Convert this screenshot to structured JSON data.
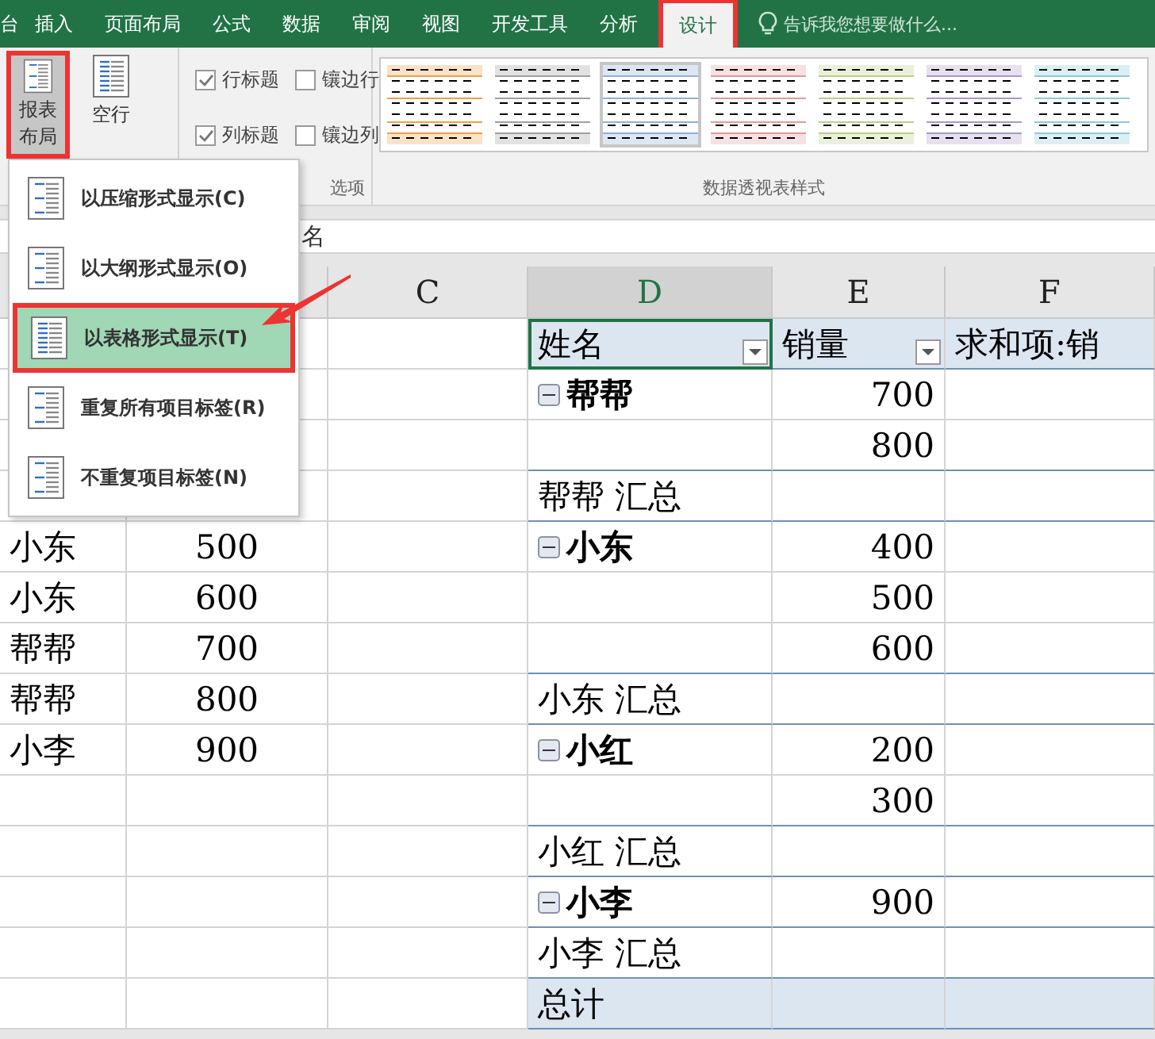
{
  "tabs": [
    {
      "label": "台",
      "selected": false
    },
    {
      "label": "插入",
      "selected": false
    },
    {
      "label": "页面布局",
      "selected": false
    },
    {
      "label": "公式",
      "selected": false
    },
    {
      "label": "数据",
      "selected": false
    },
    {
      "label": "审阅",
      "selected": false
    },
    {
      "label": "视图",
      "selected": false
    },
    {
      "label": "开发工具",
      "selected": false
    },
    {
      "label": "分析",
      "selected": false
    },
    {
      "label": "设计",
      "selected": true
    }
  ],
  "tell_me": "告诉我您想要做什么...",
  "layout_buttons": [
    {
      "label": "报表布局",
      "selected": true
    },
    {
      "label": "空行",
      "selected": false
    }
  ],
  "options": [
    {
      "label": "行标题",
      "checked": true
    },
    {
      "label": "镶边行",
      "checked": false
    },
    {
      "label": "列标题",
      "checked": true
    },
    {
      "label": "镶边列",
      "checked": false
    }
  ],
  "options_group": "选项",
  "styles": [
    {
      "color": "#f0a04a",
      "selected": false
    },
    {
      "color": "#a0a0a0",
      "selected": false
    },
    {
      "color": "#8fb0dc",
      "selected": true
    },
    {
      "color": "#e49a9a",
      "selected": false
    },
    {
      "color": "#b6d08a",
      "selected": false
    },
    {
      "color": "#ab98cc",
      "selected": false
    },
    {
      "color": "#8ccbdc",
      "selected": false
    }
  ],
  "styles_group": "数据透视表样式",
  "formula_bar": "名",
  "columns": [
    {
      "selected": false
    },
    {
      "selected": false
    },
    {
      "label": "C",
      "selected": false
    },
    {
      "label": "D",
      "selected": true
    },
    {
      "label": "E",
      "selected": false
    },
    {
      "label": "F",
      "selected": false
    }
  ],
  "rows": [
    {
      "kind": "header",
      "name": "姓名",
      "value": "销量",
      "extra": "求和项:销"
    },
    {
      "kind": "item",
      "name": "帮帮",
      "value": "700",
      "expanded": true
    },
    {
      "kind": "item",
      "value": "800"
    },
    {
      "kind": "subtotal",
      "name": "帮帮  汇总"
    },
    {
      "kind": "item",
      "left_name": "小东",
      "left_value": "500",
      "name": "小东",
      "value": "400",
      "expanded": true
    },
    {
      "kind": "item",
      "left_name": "小东",
      "left_value": "600",
      "value": "500"
    },
    {
      "kind": "item",
      "left_name": "帮帮",
      "left_value": "700",
      "value": "600"
    },
    {
      "kind": "subtotal",
      "left_name": "帮帮",
      "left_value": "800",
      "name": "小东  汇总"
    },
    {
      "kind": "item",
      "left_name": "小李",
      "left_value": "900",
      "name": "小红",
      "value": "200",
      "expanded": true
    },
    {
      "kind": "item",
      "value": "300"
    },
    {
      "kind": "subtotal",
      "name": "小红  汇总"
    },
    {
      "kind": "item",
      "name": "小李",
      "value": "900",
      "expanded": true
    },
    {
      "kind": "subtotal",
      "name": "小李  汇总"
    },
    {
      "kind": "total",
      "name": "总计"
    }
  ],
  "menu": [
    {
      "label": "以压缩形式显示(C)",
      "selected": false
    },
    {
      "label": "以大纲形式显示(O)",
      "selected": false
    },
    {
      "label": "以表格形式显示(T)",
      "selected": true
    },
    {
      "label": "重复所有项目标签(R)",
      "selected": false
    },
    {
      "label": "不重复项目标签(N)",
      "selected": false
    }
  ]
}
